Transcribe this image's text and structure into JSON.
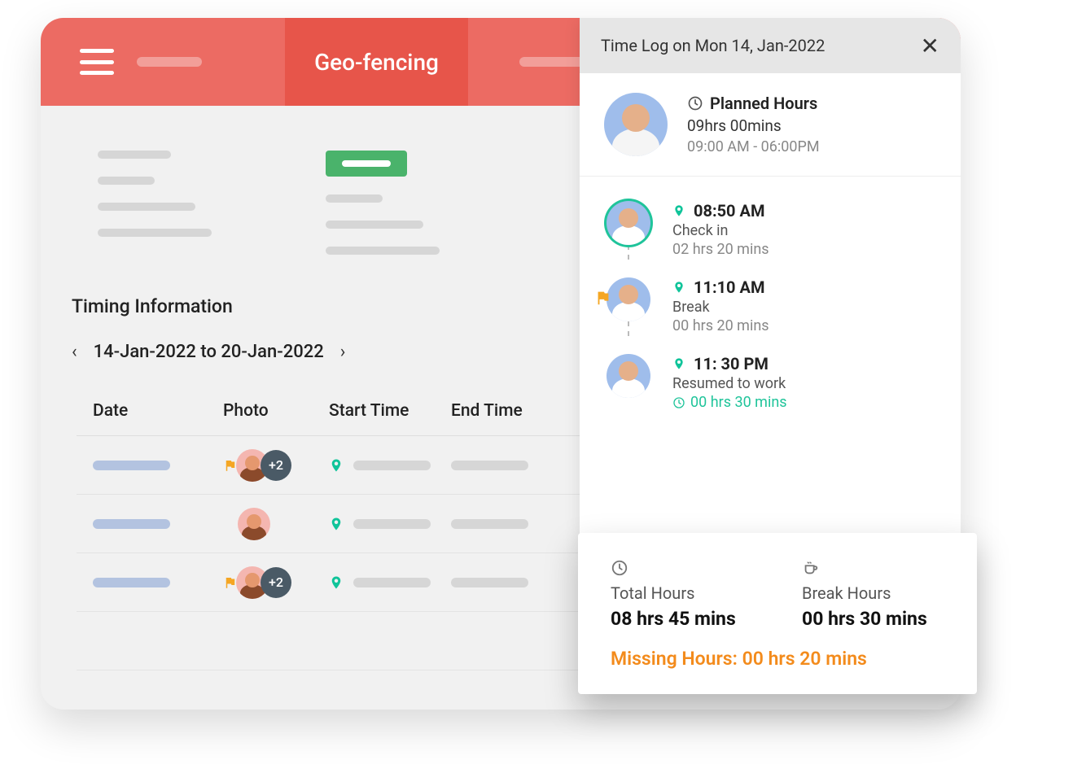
{
  "header": {
    "active_tab": "Geo-fencing"
  },
  "timing": {
    "section_title": "Timing Information",
    "range": "14-Jan-2022 to 20-Jan-2022",
    "columns": {
      "date": "Date",
      "photo": "Photo",
      "start": "Start Time",
      "end": "End Time"
    },
    "rows": [
      {
        "extra_badge": "+2",
        "has_flag": true
      },
      {
        "extra_badge": "",
        "has_flag": false
      },
      {
        "extra_badge": "+2",
        "has_flag": true
      }
    ]
  },
  "panel": {
    "title": "Time Log on Mon 14, Jan-2022",
    "planned": {
      "label": "Planned Hours",
      "hours": "09hrs 00mins",
      "range": "09:00 AM - 06:00PM"
    },
    "timeline": [
      {
        "time": "08:50 AM",
        "label": "Check in",
        "duration": "02 hrs 20 mins",
        "ring": true,
        "flag": false,
        "green_dur": false
      },
      {
        "time": "11:10 AM",
        "label": "Break",
        "duration": "00 hrs 20 mins",
        "ring": false,
        "flag": true,
        "green_dur": false
      },
      {
        "time": "11: 30 PM",
        "label": "Resumed to work",
        "duration": "00 hrs 30 mins",
        "ring": false,
        "flag": false,
        "green_dur": true
      }
    ]
  },
  "summary": {
    "total_label": "Total Hours",
    "total_value": "08 hrs 45 mins",
    "break_label": "Break Hours",
    "break_value": "00 hrs 30 mins",
    "missing": "Missing Hours: 00 hrs 20 mins"
  }
}
